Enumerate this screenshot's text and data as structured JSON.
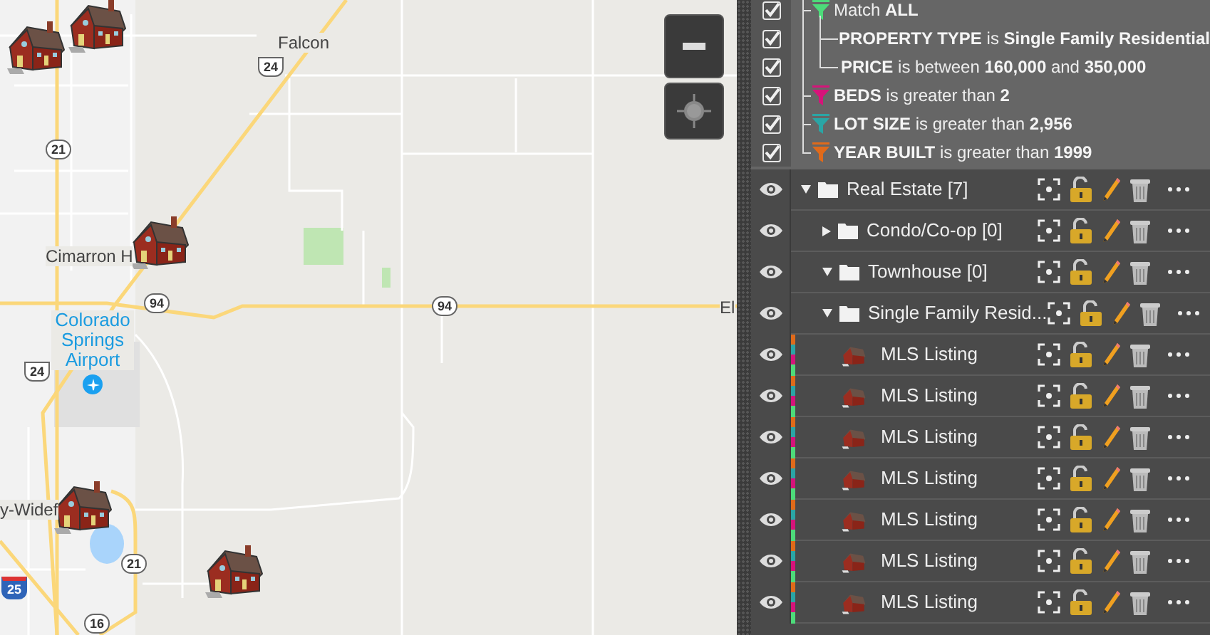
{
  "map": {
    "places": [
      {
        "text": "Falcon",
        "kind": "town"
      },
      {
        "text": "Cimarron H",
        "kind": "town"
      },
      {
        "text": "Colorado Springs Airport",
        "kind": "airport"
      },
      {
        "text": "y-Widef",
        "kind": "town"
      },
      {
        "text": "El",
        "kind": "town"
      }
    ],
    "shields": [
      {
        "text": "24",
        "kind": "us"
      },
      {
        "text": "21",
        "kind": "state"
      },
      {
        "text": "94",
        "kind": "state"
      },
      {
        "text": "94",
        "kind": "state"
      },
      {
        "text": "24",
        "kind": "us"
      },
      {
        "text": "21",
        "kind": "state"
      },
      {
        "text": "25",
        "kind": "interstate"
      },
      {
        "text": "16",
        "kind": "state"
      }
    ],
    "markers": [
      {
        "kind": "house"
      },
      {
        "kind": "house"
      },
      {
        "kind": "house"
      },
      {
        "kind": "house"
      },
      {
        "kind": "house"
      }
    ],
    "controls": [
      {
        "kind": "zoom-out"
      },
      {
        "kind": "locate"
      }
    ]
  },
  "filters": [
    {
      "kind": "group",
      "checked": true,
      "color": "#4ddb7a",
      "text": "Match **ALL**",
      "children": [
        {
          "kind": "condition",
          "checked": true,
          "text": "**PROPERTY TYPE** is **Single Family Residential**"
        },
        {
          "kind": "condition",
          "checked": true,
          "text": "**PRICE** is between **160,000** and **350,000**"
        }
      ]
    },
    {
      "kind": "filter",
      "checked": true,
      "color": "#d6137a",
      "text": "**BEDS** is greater than **2**"
    },
    {
      "kind": "filter",
      "checked": true,
      "color": "#2aa5a5",
      "text": "**LOT SIZE** is greater than **2,956**"
    },
    {
      "kind": "filter",
      "checked": true,
      "color": "#e06a1a",
      "text": "**YEAR BUILT** is greater than **1999**"
    }
  ],
  "layers": [
    {
      "kind": "folder",
      "name": "Real Estate [7]",
      "expanded": true,
      "children": [
        {
          "kind": "folder",
          "name": "Condo/Co-op [0]",
          "expanded": false
        },
        {
          "kind": "folder",
          "name": "Townhouse [0]",
          "expanded": true
        },
        {
          "kind": "folder",
          "name": "Single Family Resid...",
          "expanded": true,
          "children": [
            {
              "kind": "listing",
              "name": "MLS Listing"
            },
            {
              "kind": "listing",
              "name": "MLS Listing"
            },
            {
              "kind": "listing",
              "name": "MLS Listing"
            },
            {
              "kind": "listing",
              "name": "MLS Listing"
            },
            {
              "kind": "listing",
              "name": "MLS Listing"
            },
            {
              "kind": "listing",
              "name": "MLS Listing"
            },
            {
              "kind": "listing",
              "name": "MLS Listing"
            }
          ]
        }
      ]
    }
  ]
}
